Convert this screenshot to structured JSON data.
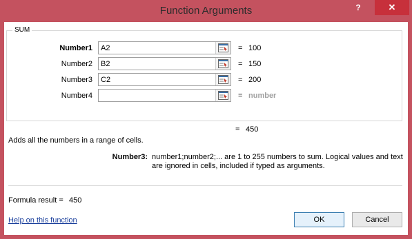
{
  "dialog": {
    "title": "Function Arguments",
    "help_glyph": "?",
    "close_glyph": "✕"
  },
  "function_group": {
    "name": "SUM",
    "arguments": [
      {
        "label": "Number1",
        "input": "A2",
        "value": "100",
        "bold": true
      },
      {
        "label": "Number2",
        "input": "B2",
        "value": "150",
        "bold": false
      },
      {
        "label": "Number3",
        "input": "C2",
        "value": "200",
        "bold": false
      },
      {
        "label": "Number4",
        "input": "",
        "value": "number",
        "bold": false
      }
    ],
    "equals": "="
  },
  "total": {
    "equals": "=",
    "value": "450"
  },
  "description": "Adds all the numbers in a range of cells.",
  "argument_help": {
    "name": "Number3:",
    "text": "number1;number2;... are 1 to 255 numbers to sum. Logical values and text are ignored in cells, included if typed as arguments."
  },
  "formula_result": {
    "label": "Formula result =",
    "value": "450"
  },
  "help_link": "Help on this function",
  "buttons": {
    "ok": "OK",
    "cancel": "Cancel"
  },
  "colors": {
    "frame": "#c4525f",
    "close": "#c7303b",
    "link": "#1a3f9c"
  },
  "icons": {
    "ref_button": "collapse-dialog-icon"
  }
}
